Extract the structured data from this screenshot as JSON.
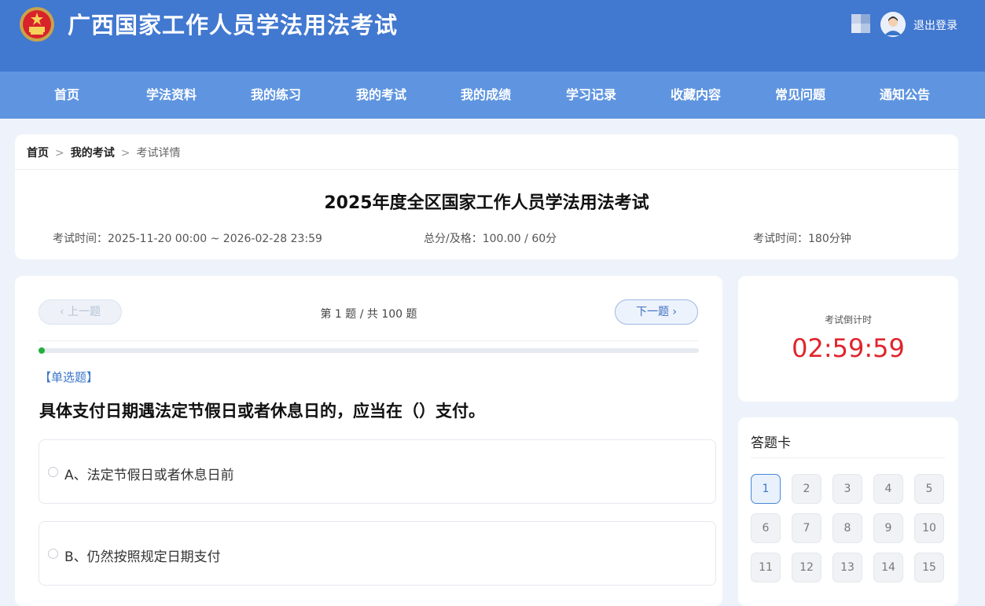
{
  "header": {
    "site_title": "广西国家工作人员学法用法考试",
    "logout_label": "退出登录",
    "brand_colors": {
      "header_bg": "#4178d0",
      "nav_bg": "#5f95e0",
      "accent": "#3b75c9",
      "timer": "#e0242c",
      "progress": "#20b040"
    }
  },
  "nav": {
    "items": [
      "首页",
      "学法资料",
      "我的练习",
      "我的考试",
      "我的成绩",
      "学习记录",
      "收藏内容",
      "常见问题",
      "通知公告"
    ]
  },
  "breadcrumb": {
    "home": "首页",
    "exams": "我的考试",
    "current": "考试详情",
    "separator": ">"
  },
  "exam": {
    "title": "2025年度全区国家工作人员学法用法考试",
    "time_range": "考试时间：2025-11-20 00:00 ~ 2026-02-28 23:59",
    "score": "总分/及格：100.00 / 60分",
    "duration": "考试时间：180分钟"
  },
  "question": {
    "prev_label": "‹ 上一题",
    "next_label": "下一题 ›",
    "progress_text": "第 1 题 / 共 100 题",
    "progress_fraction": 0.01,
    "type": "【单选题】",
    "text": "具体支付日期遇法定节假日或者休息日的，应当在（）支付。",
    "options": [
      "A、法定节假日或者休息日前",
      "B、仍然按照规定日期支付"
    ]
  },
  "timer": {
    "label": "考试倒计时",
    "value": "02:59:59"
  },
  "answer_card": {
    "title": "答题卡",
    "current": 1,
    "numbers": [
      "1",
      "2",
      "3",
      "4",
      "5",
      "6",
      "7",
      "8",
      "9",
      "10",
      "11",
      "12",
      "13",
      "14",
      "15"
    ]
  }
}
